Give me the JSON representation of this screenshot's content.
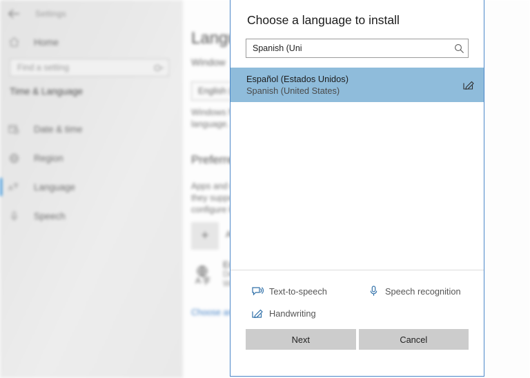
{
  "app": {
    "title": "Settings",
    "back_icon": "back-arrow-icon",
    "home_label": "Home",
    "home_icon": "home-icon",
    "search_placeholder": "Find a setting",
    "search_icon": "search-icon",
    "group_header": "Time & Language",
    "accent_color": "#2f8fd8",
    "nav_items": [
      {
        "label": "Date & time",
        "icon": "calendar-clock-icon",
        "selected": false
      },
      {
        "label": "Region",
        "icon": "globe-region-icon",
        "selected": false
      },
      {
        "label": "Language",
        "icon": "language-characters-icon",
        "selected": true
      },
      {
        "label": "Speech",
        "icon": "microphone-icon",
        "selected": false
      }
    ]
  },
  "content": {
    "heading": "Langu",
    "subheading": "Window",
    "display_language_value": "English (U",
    "paragraph": "Windows f\nlanguage.",
    "section_heading": "Preferred",
    "section_paragraph": "Apps and w\nthey suppo\nconfigure k",
    "add_icon": "plus-icon",
    "add_label": "Ad",
    "installed_icon": "language-globe-icon",
    "installed_line1": "Eng",
    "installed_line2": "Def",
    "installed_line3": "Win—",
    "link_text": "Choose an"
  },
  "dialog": {
    "title": "Choose a language to install",
    "search_value": "Spanish (Uni",
    "search_placeholder": "",
    "search_icon": "search-icon",
    "results": [
      {
        "native_name": "Español (Estados Unidos)",
        "english_name": "Spanish (United States)",
        "icon": "handwriting-pen-icon",
        "selected": true
      }
    ],
    "features": [
      {
        "label": "Text-to-speech",
        "icon": "text-to-speech-icon"
      },
      {
        "label": "Speech recognition",
        "icon": "microphone-icon"
      },
      {
        "label": "Handwriting",
        "icon": "handwriting-pen-icon"
      }
    ],
    "next_label": "Next",
    "cancel_label": "Cancel",
    "selection_color": "#8fbcdb",
    "border_color": "#4a86c8",
    "button_color": "#cccccc"
  }
}
